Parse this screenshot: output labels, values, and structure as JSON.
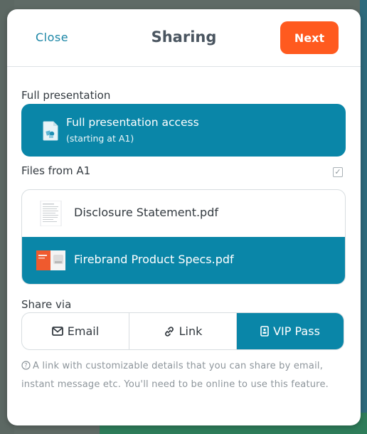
{
  "header": {
    "close_label": "Close",
    "title": "Sharing",
    "next_label": "Next"
  },
  "full_presentation": {
    "section_label": "Full presentation",
    "title": "Full presentation access",
    "subtitle": "(starting at A1)"
  },
  "files": {
    "section_label": "Files from A1",
    "items": [
      {
        "name": "Disclosure Statement.pdf",
        "selected": false
      },
      {
        "name": "Firebrand Product Specs.pdf",
        "selected": true
      }
    ]
  },
  "share_via": {
    "section_label": "Share via",
    "options": [
      {
        "label": "Email",
        "icon": "envelope-icon",
        "active": false
      },
      {
        "label": "Link",
        "icon": "link-icon",
        "active": false
      },
      {
        "label": "VIP Pass",
        "icon": "badge-icon",
        "active": true
      }
    ],
    "help_text": "A link with customizable details that you can share by email, instant message etc. You'll need to be online to use this feature."
  },
  "colors": {
    "accent": "#0a86a8",
    "next_button": "#ff5a1f",
    "link_text": "#1b86a6"
  }
}
